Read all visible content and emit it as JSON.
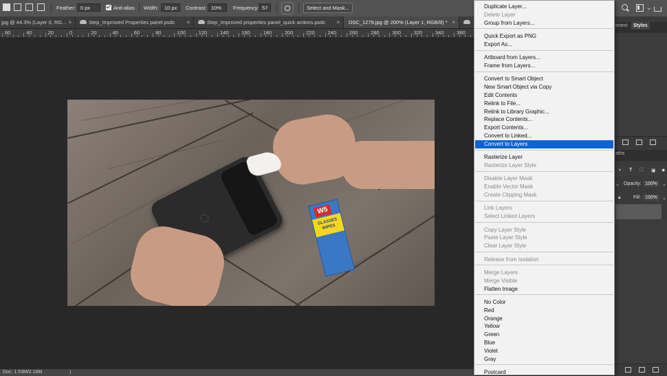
{
  "options_bar": {
    "feather_label": "Feather:",
    "feather_value": "0 px",
    "antialias_label": "Anti-alias",
    "width_label": "Width:",
    "width_value": "10 px",
    "contrast_label": "Contrast:",
    "contrast_value": "10%",
    "frequency_label": "Frequency:",
    "frequency_value": "57",
    "select_mask_label": "Select and Mask..."
  },
  "tabs": [
    {
      "label": "jpg @ 44.3% (Layer 0, RG...",
      "close": "×"
    },
    {
      "label": "Step_Improved Properties panel.psdc",
      "close": "×"
    },
    {
      "label": "Step_Improved properties panel_quick actions.psdc",
      "close": "×"
    },
    {
      "label": "DSC_1279.jpg @ 200% (Layer 1, RGB/8) *",
      "close": "×"
    }
  ],
  "ruler": [
    "60",
    "40",
    "20",
    "0",
    "20",
    "40",
    "60",
    "80",
    "100",
    "120",
    "140",
    "160",
    "180",
    "200",
    "220",
    "240",
    "260",
    "280",
    "300",
    "320",
    "340",
    "360"
  ],
  "status_bar": {
    "doc_info": "Doc: 1.53M/2.18M",
    "arrow": ")"
  },
  "right_panel": {
    "tab_adjustments": "tment",
    "tab_styles": "Styles",
    "tab_paths": "aths",
    "opacity_label": "Opacity:",
    "opacity_value": "100%",
    "fill_label": "Fill:",
    "fill_value": "100%"
  },
  "photo": {
    "wipes_logo": "W5",
    "wipes_text": "GLASSES WIPES"
  },
  "context_menu": {
    "items": [
      {
        "label": "Duplicate Layer...",
        "disabled": false
      },
      {
        "label": "Delete Layer",
        "disabled": true
      },
      {
        "label": "Group from Layers...",
        "disabled": false
      },
      {
        "sep": true
      },
      {
        "label": "Quick Export as PNG",
        "disabled": false
      },
      {
        "label": "Export As...",
        "disabled": false
      },
      {
        "sep": true
      },
      {
        "label": "Artboard from Layers...",
        "disabled": false
      },
      {
        "label": "Frame from Layers...",
        "disabled": false
      },
      {
        "sep": true
      },
      {
        "label": "Convert to Smart Object",
        "disabled": false
      },
      {
        "label": "New Smart Object via Copy",
        "disabled": false
      },
      {
        "label": "Edit Contents",
        "disabled": false
      },
      {
        "label": "Relink to File...",
        "disabled": false
      },
      {
        "label": "Relink to Library Graphic...",
        "disabled": false
      },
      {
        "label": "Replace Contents...",
        "disabled": false
      },
      {
        "label": "Export Contents...",
        "disabled": false
      },
      {
        "label": "Convert to Linked...",
        "disabled": false
      },
      {
        "label": "Convert to Layers",
        "disabled": false,
        "highlighted": true
      },
      {
        "sep": true
      },
      {
        "label": "Rasterize Layer",
        "disabled": false
      },
      {
        "label": "Rasterize Layer Style",
        "disabled": true
      },
      {
        "sep": true
      },
      {
        "label": "Disable Layer Mask",
        "disabled": true
      },
      {
        "label": "Enable Vector Mask",
        "disabled": true
      },
      {
        "label": "Create Clipping Mask",
        "disabled": true
      },
      {
        "sep": true
      },
      {
        "label": "Link Layers",
        "disabled": true
      },
      {
        "label": "Select Linked Layers",
        "disabled": true
      },
      {
        "sep": true
      },
      {
        "label": "Copy Layer Style",
        "disabled": true
      },
      {
        "label": "Paste Layer Style",
        "disabled": true
      },
      {
        "label": "Clear Layer Style",
        "disabled": true
      },
      {
        "sep": true
      },
      {
        "label": "Release from Isolation",
        "disabled": true
      },
      {
        "sep": true
      },
      {
        "label": "Merge Layers",
        "disabled": true
      },
      {
        "label": "Merge Visible",
        "disabled": true
      },
      {
        "label": "Flatten Image",
        "disabled": false
      },
      {
        "sep": true
      },
      {
        "label": "No Color",
        "disabled": false
      },
      {
        "label": "Red",
        "disabled": false
      },
      {
        "label": "Orange",
        "disabled": false
      },
      {
        "label": "Yellow",
        "disabled": false
      },
      {
        "label": "Green",
        "disabled": false
      },
      {
        "label": "Blue",
        "disabled": false
      },
      {
        "label": "Violet",
        "disabled": false
      },
      {
        "label": "Gray",
        "disabled": false
      },
      {
        "sep": true
      },
      {
        "label": "Postcard",
        "disabled": false
      }
    ]
  }
}
